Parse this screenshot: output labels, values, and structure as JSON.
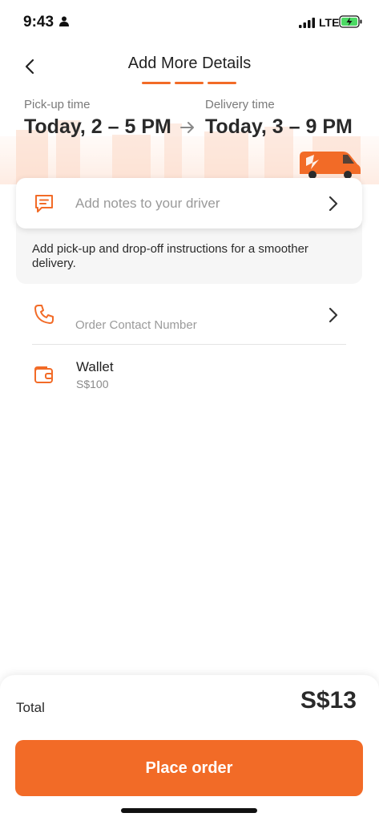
{
  "status_bar": {
    "time": "9:43",
    "network": "LTE",
    "icons": [
      "person-icon",
      "signal-icon",
      "battery-charging-icon"
    ]
  },
  "header": {
    "title": "Add More Details",
    "back_icon": "chevron-left-icon",
    "steps_total": 3,
    "steps_completed": 3
  },
  "schedule": {
    "pickup_label": "Pick-up time",
    "pickup_value": "Today, 2 – 5 PM",
    "delivery_label": "Delivery time",
    "delivery_value": "Today, 3 – 9 PM",
    "arrow_icon": "arrow-right-icon",
    "vehicle_icon": "van-icon"
  },
  "notes": {
    "placeholder": "Add notes to your driver",
    "help_text": "Add pick-up and drop-off instructions for a smoother delivery.",
    "icon": "message-icon"
  },
  "contact": {
    "placeholder": "Order Contact Number",
    "icon": "phone-icon"
  },
  "wallet": {
    "title": "Wallet",
    "balance": "S$100",
    "icon": "wallet-icon"
  },
  "footer": {
    "total_label": "Total",
    "total_value": "S$13",
    "place_order_label": "Place order"
  },
  "colors": {
    "accent": "#f26b27",
    "text_primary": "#2a2a2a",
    "text_secondary": "#9a9a9a"
  }
}
